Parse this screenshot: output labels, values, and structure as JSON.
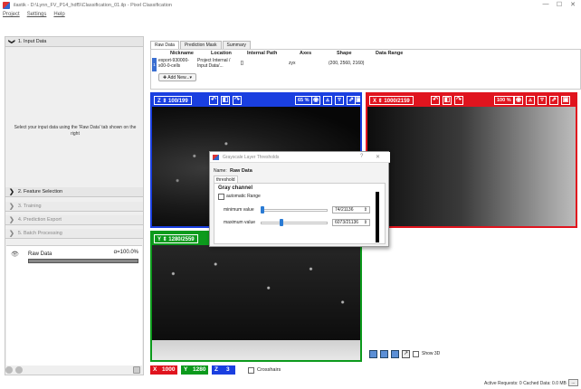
{
  "window": {
    "title": "ilastik - D:\\Lynn_FV_P14_hdf5\\Classification_01.ilp - Pixel Classification",
    "controls": [
      "—",
      "☐",
      "✕"
    ]
  },
  "menu": [
    "Project",
    "Settings",
    "Help"
  ],
  "left_panel": {
    "sections": [
      {
        "label": "1. Input Data",
        "chevron": "❯",
        "expanded": true
      },
      {
        "label": "2. Feature Selection",
        "chevron": "❯",
        "expanded": false
      },
      {
        "label": "3. Training",
        "chevron": "❯",
        "expanded": false
      },
      {
        "label": "4. Prediction Export",
        "chevron": "❯",
        "expanded": false
      },
      {
        "label": "5. Batch Processing",
        "chevron": "❯",
        "expanded": false
      }
    ],
    "message": "Select your input data using the 'Raw Data' tab shown on the right",
    "layers": [
      {
        "name": "Raw Data",
        "opacity": "α=100.0%"
      }
    ]
  },
  "tabs": [
    "Raw Data",
    "Prediction Mask",
    "Summary"
  ],
  "table": {
    "headers": [
      "Nickname",
      "Location",
      "Internal Path",
      "Axes",
      "Shape",
      "Data Range"
    ],
    "rows": [
      {
        "index": "1",
        "nickname": "export-930000-s00-0-cells",
        "location": "Project Internal / Input Data/...",
        "internal_path": "[]",
        "axes": "zyx",
        "shape": "(200, 2560, 2160)",
        "data_range": ""
      }
    ],
    "add_new_label": "✚ Add New...▾"
  },
  "viewers": {
    "top_left": {
      "axis": "Z",
      "coord": "100/199",
      "zoom": "65 %",
      "color": "#1a3fe0"
    },
    "top_right": {
      "axis": "X",
      "coord": "1000/2159",
      "zoom": "100 %",
      "color": "#e0141e"
    },
    "bottom_left": {
      "axis": "Y",
      "coord": "1280/2559",
      "color": "#0c9a1c"
    }
  },
  "bottom_bar": {
    "x_label": "X",
    "x_value": "1000",
    "y_label": "Y",
    "y_value": "1280",
    "z_label": "Z",
    "z_value": "3",
    "crosshairs_label": "Crosshairs",
    "show3d_label": "Show 3D"
  },
  "dialog": {
    "title": "Grayscale Layer Thresholds",
    "help": "?",
    "close": "✕",
    "name_label": "Name:",
    "name_value": "Raw Data",
    "tab": "threshold",
    "group_title": "Gray channel",
    "auto_range_label": "automatic Range",
    "min_label": "minimum value",
    "min_value": "74/21136",
    "min_fraction": 0.0035,
    "max_label": "maximum value",
    "max_value": "6073/21136",
    "max_fraction": 0.287
  },
  "status": "Active Requests: 0  Cached Data: 0.0 MB"
}
